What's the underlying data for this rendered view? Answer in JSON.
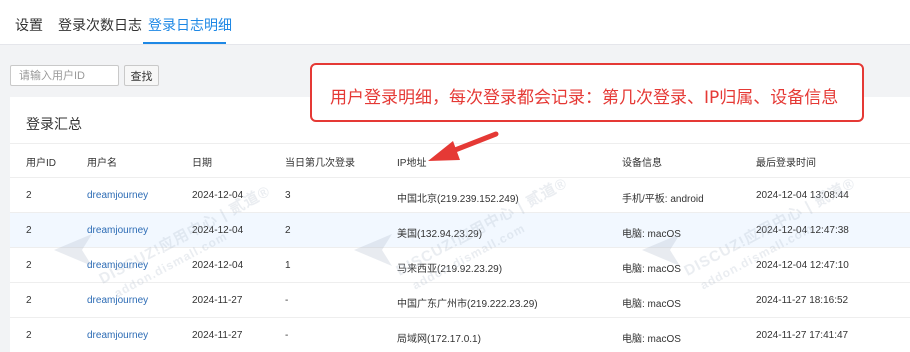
{
  "tabs": [
    {
      "label": "设置",
      "active": false
    },
    {
      "label": "登录次数日志",
      "active": false
    },
    {
      "label": "登录日志明细",
      "active": true
    }
  ],
  "search": {
    "placeholder": "请输入用户ID",
    "button_label": "查找"
  },
  "panel": {
    "title": "登录汇总"
  },
  "table": {
    "headers": [
      "用户ID",
      "用户名",
      "日期",
      "当日第几次登录",
      "IP地址",
      "设备信息",
      "最后登录时间"
    ],
    "rows": [
      [
        "2",
        "dreamjourney",
        "2024-12-04",
        "3",
        "中国北京(219.239.152.249)",
        "手机/平板: android",
        "2024-12-04 13:08:44"
      ],
      [
        "2",
        "dreamjourney",
        "2024-12-04",
        "2",
        "美国(132.94.23.29)",
        "电脑: macOS",
        "2024-12-04 12:47:38"
      ],
      [
        "2",
        "dreamjourney",
        "2024-12-04",
        "1",
        "马来西亚(219.92.23.29)",
        "电脑: macOS",
        "2024-12-04 12:47:10"
      ],
      [
        "2",
        "dreamjourney",
        "2024-11-27",
        "-",
        "中国广东广州市(219.222.23.29)",
        "电脑: macOS",
        "2024-11-27 18:16:52"
      ],
      [
        "2",
        "dreamjourney",
        "2024-11-27",
        "-",
        "局域网(172.17.0.1)",
        "电脑: macOS",
        "2024-11-27 17:41:47"
      ]
    ]
  },
  "callout": {
    "text": "用户登录明细，每次登录都会记录：第几次登录、IP归属、设备信息"
  },
  "watermark": {
    "brand": "DISCUZ!应用中心 | 贰道®",
    "domain": "addon.dismall.com"
  },
  "colors": {
    "accent": "#1e88e5",
    "callout_red": "#e53935",
    "link": "#2d6cb5",
    "row_highlight": "#f2f8ff"
  }
}
